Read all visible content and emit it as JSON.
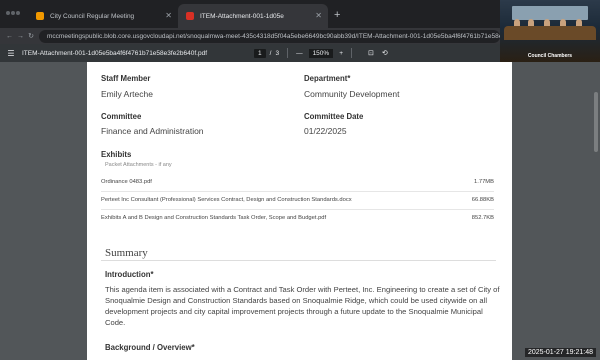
{
  "browser": {
    "tabs": [
      {
        "title": "City Council Regular Meeting",
        "close": "✕"
      },
      {
        "title": "ITEM-Attachment-001-1d05e",
        "close": "✕"
      }
    ],
    "new_tab": "+",
    "url": "mccmeetingspublic.blob.core.usgovcloudapi.net/snoqualmwa-meet-435c4318d5f04a5ebe6649bc90abb39d/ITEM-Attachment-001-1d05e5ba4f6f4761b71e58e3fe2b"
  },
  "pdf_viewer": {
    "filename": "ITEM-Attachment-001-1d05e5ba4f6f4761b71e58e3fe2b640f.pdf",
    "page_current": "1",
    "page_sep": "/",
    "page_total": "3",
    "zoom_minus": "—",
    "zoom": "150%",
    "zoom_plus": "+"
  },
  "document": {
    "staff_member_label": "Staff Member",
    "staff_member_value": "Emily Arteche",
    "department_label": "Department*",
    "department_value": "Community Development",
    "committee_label": "Committee",
    "committee_value": "Finance and Administration",
    "committee_date_label": "Committee Date",
    "committee_date_value": "01/22/2025",
    "exhibits_label": "Exhibits",
    "exhibits_sub": "Packet Attachments - if any",
    "exhibits": [
      {
        "name": "Ordinance 0483.pdf",
        "size": "1.77MB"
      },
      {
        "name": "Perteet Inc Consultant (Professional) Services Contract, Design and Construction Standards.docx",
        "size": "66.88KB"
      },
      {
        "name": "Exhibits A and B Design and Construction Standards Task Order, Scope and Budget.pdf",
        "size": "852.7KB"
      }
    ],
    "summary_heading": "Summary",
    "introduction_label": "Introduction*",
    "introduction_text": "This agenda item is associated with a Contract and Task Order with Perteet, Inc. Engineering to create a set of City of Snoqualmie Design and Construction Standards based on Snoqualmie Ridge, which could be used citywide on all development projects and city capital improvement projects through a future update to the Snoqualmie Municipal Code.",
    "background_label": "Background / Overview*"
  },
  "overlay": {
    "camera_label": "Council Chambers",
    "timestamp": "2025-01-27  19:21:48"
  }
}
